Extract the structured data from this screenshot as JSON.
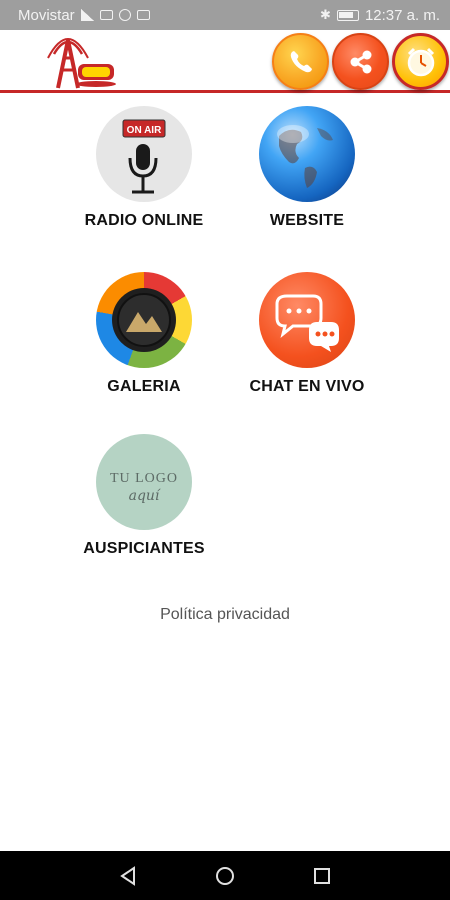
{
  "status_bar": {
    "carrier": "Movistar",
    "time": "12:37 a. m."
  },
  "header": {
    "logo_icon": "radio-tower-logo",
    "actions": [
      {
        "icon": "phone-icon"
      },
      {
        "icon": "share-icon"
      },
      {
        "icon": "alarm-clock-icon"
      }
    ]
  },
  "menu": {
    "items": [
      {
        "label": "RADIO ONLINE",
        "icon": "on-air-microphone-icon",
        "badge": "ON AIR"
      },
      {
        "label": "WEBSITE",
        "icon": "globe-icon"
      },
      {
        "label": "GALERIA",
        "icon": "gallery-icon"
      },
      {
        "label": "CHAT EN VIVO",
        "icon": "chat-bubbles-icon"
      },
      {
        "label": "AUSPICIANTES",
        "icon": "sponsor-logo-icon",
        "placeholder_text": "TU LOGO",
        "script_text": "aquí"
      }
    ]
  },
  "footer": {
    "privacy_link": "Política privacidad"
  },
  "nav_bar": {
    "buttons": [
      "back-icon",
      "home-icon",
      "recents-icon"
    ]
  },
  "colors": {
    "accent": "#c62828",
    "status_bar_bg": "#9e9e9e",
    "nav_bar_bg": "#000000"
  }
}
